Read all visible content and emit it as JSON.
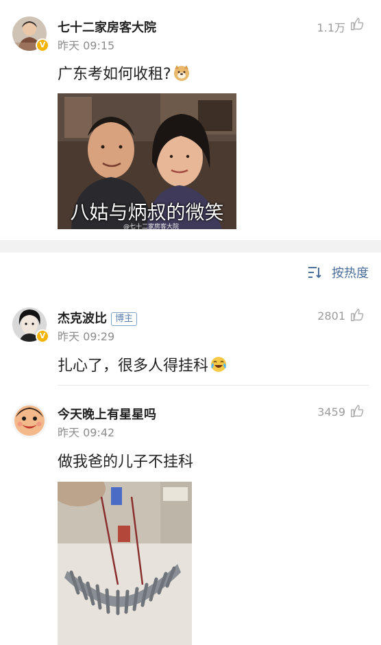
{
  "post": {
    "author": "七十二家房客大院",
    "time": "昨天 09:15",
    "likes": "1.1万",
    "text": "广东考如何收租?",
    "image_caption": "八姑与炳叔的微笑",
    "image_watermark": "@七十二家房客大院"
  },
  "sort": {
    "label": "按热度",
    "icon": "sort-icon"
  },
  "comments": [
    {
      "author": "杰克波比",
      "tag": "博主",
      "time": "昨天 09:29",
      "likes": "2801",
      "text": "扎心了，很多人得挂科"
    },
    {
      "author": "今天晚上有星星吗",
      "time": "昨天 09:42",
      "likes": "3459",
      "text": "做我爸的儿子不挂科"
    }
  ],
  "colors": {
    "link_blue": "#4a6e9a",
    "badge_gold": "#f5b400",
    "muted_gray": "#8c8c8c",
    "band_gray": "#f2f2f2"
  }
}
